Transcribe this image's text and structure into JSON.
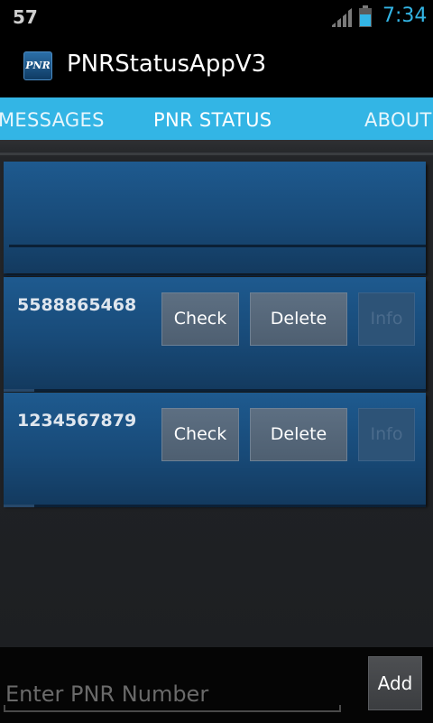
{
  "status_bar": {
    "notification_count": "57",
    "time": "7:34",
    "signal_icon": "signal-bars-icon",
    "battery_icon": "battery-icon"
  },
  "action_bar": {
    "app_icon_text": "PNR",
    "title": "PNRStatusAppV3"
  },
  "tabs": [
    {
      "label": "MESSAGES"
    },
    {
      "label": "PNR STATUS",
      "selected": true
    },
    {
      "label": "ABOUT"
    }
  ],
  "pnr_list": [
    {
      "pnr": "5588865468",
      "check_label": "Check",
      "delete_label": "Delete",
      "info_label": "Info"
    },
    {
      "pnr": "1234567879",
      "check_label": "Check",
      "delete_label": "Delete",
      "info_label": "Info"
    }
  ],
  "input_bar": {
    "placeholder": "Enter PNR Number",
    "value": "",
    "add_label": "Add"
  },
  "colors": {
    "accent": "#33b5e5",
    "card": "#1e5a8f",
    "button": "#5d6f82"
  }
}
